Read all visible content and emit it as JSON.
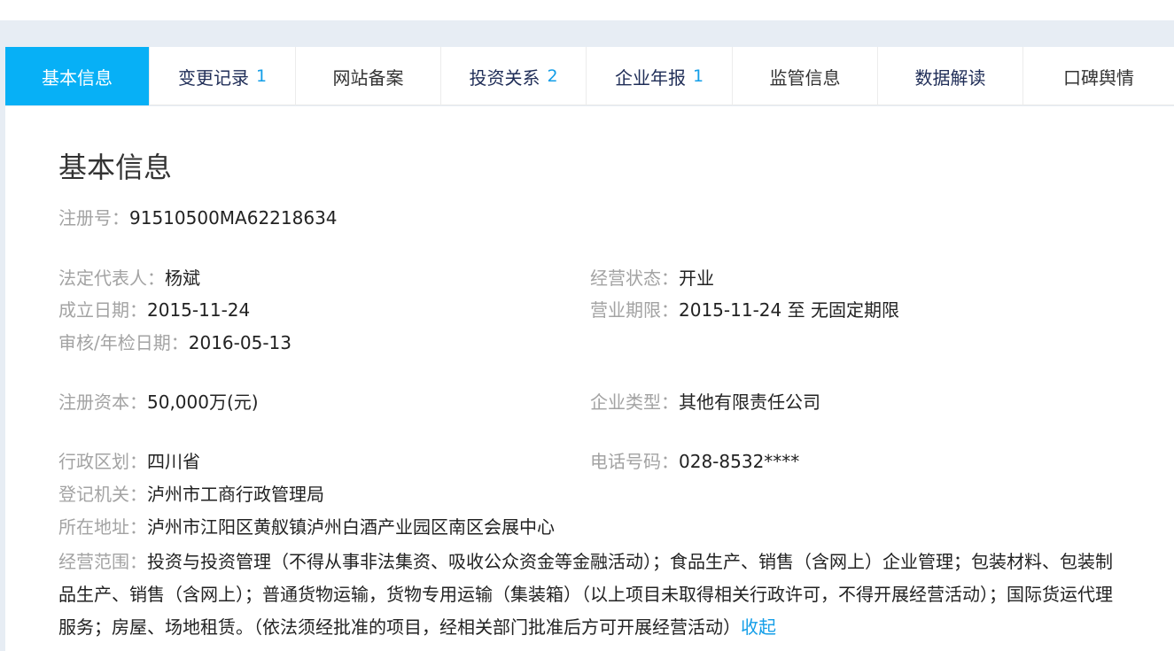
{
  "tabs": [
    {
      "label": "基本信息",
      "count": ""
    },
    {
      "label": "变更记录",
      "count": "1"
    },
    {
      "label": "网站备案",
      "count": ""
    },
    {
      "label": "投资关系",
      "count": "2"
    },
    {
      "label": "企业年报",
      "count": "1"
    },
    {
      "label": "监管信息",
      "count": ""
    },
    {
      "label": "数据解读",
      "count": ""
    },
    {
      "label": "口碑舆情",
      "count": ""
    }
  ],
  "section": {
    "title": "基本信息"
  },
  "fields": {
    "reg_no": {
      "label": "注册号：",
      "value": "91510500MA62218634"
    },
    "legal_rep": {
      "label": "法定代表人：",
      "value": "杨斌"
    },
    "status": {
      "label": "经营状态：",
      "value": "开业"
    },
    "founded": {
      "label": "成立日期：",
      "value": "2015-11-24"
    },
    "term": {
      "label": "营业期限：",
      "value": "2015-11-24 至 无固定期限"
    },
    "audit_date": {
      "label": "审核/年检日期：",
      "value": "2016-05-13"
    },
    "capital": {
      "label": "注册资本：",
      "value": "50,000万(元)"
    },
    "company_type": {
      "label": "企业类型：",
      "value": "其他有限责任公司"
    },
    "region": {
      "label": "行政区划：",
      "value": "四川省"
    },
    "phone": {
      "label": "电话号码：",
      "value": "028-8532****"
    },
    "authority": {
      "label": "登记机关：",
      "value": "泸州市工商行政管理局"
    },
    "address": {
      "label": "所在地址：",
      "value": "泸州市江阳区黄舣镇泸州白酒产业园区南区会展中心"
    },
    "scope": {
      "label": "经营范围：",
      "value": "投资与投资管理（不得从事非法集资、吸收公众资金等金融活动）；食品生产、销售（含网上）企业管理；包装材料、包装制品生产、销售（含网上）；普通货物运输，货物专用运输（集装箱）（以上项目未取得相关行政许可，不得开展经营活动）；国际货运代理服务；房屋、场地租赁。（依法须经批准的项目，经相关部门批准后方可开展经营活动）",
      "collapse": "收起"
    }
  },
  "colors": {
    "active_tab": "#07b0f6",
    "link": "#139ee8",
    "label": "#a3a3a3",
    "page_bg": "#e7edf4"
  }
}
